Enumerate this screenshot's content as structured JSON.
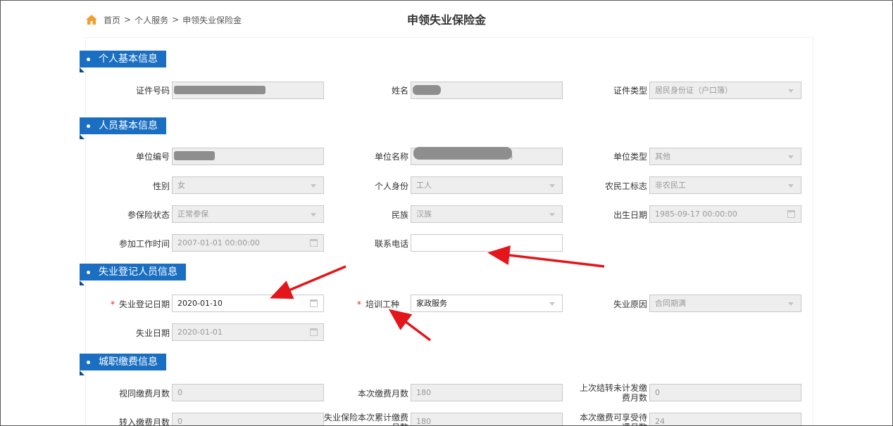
{
  "breadcrumb": {
    "home": "首页",
    "sep": ">",
    "items": [
      "个人服务",
      "申领失业保险金"
    ]
  },
  "page_title": "申领失业保险金",
  "sections": {
    "personal": "个人基本信息",
    "staff": "人员基本信息",
    "unemployment": "失业登记人员信息",
    "payment": "城职缴费信息"
  },
  "fields": {
    "id_number": {
      "label": "证件号码",
      "value": ""
    },
    "name": {
      "label": "姓名",
      "value": ""
    },
    "id_type": {
      "label": "证件类型",
      "value": "居民身份证（户口簿）"
    },
    "unit_code": {
      "label": "单位编号",
      "value": ""
    },
    "unit_name": {
      "label": "单位名称",
      "value": ")"
    },
    "unit_type": {
      "label": "单位类型",
      "value": "其他"
    },
    "gender": {
      "label": "性别",
      "value": "女"
    },
    "identity": {
      "label": "个人身份",
      "value": "工人"
    },
    "migrant_flag": {
      "label": "农民工标志",
      "value": "非农民工"
    },
    "insured_status": {
      "label": "参保险状态",
      "value": "正常参保"
    },
    "ethnicity": {
      "label": "民族",
      "value": "汉族"
    },
    "birth_date": {
      "label": "出生日期",
      "value": "1985-09-17 00:00:00"
    },
    "work_start": {
      "label": "参加工作时间",
      "value": "2007-01-01 00:00:00"
    },
    "phone": {
      "label": "联系电话",
      "value": ""
    },
    "reg_date": {
      "label": "失业登记日期",
      "value": "2020-01-10",
      "required": "*"
    },
    "training": {
      "label": "培训工种",
      "value": "家政服务",
      "required": "*"
    },
    "reason": {
      "label": "失业原因",
      "value": "合同期满"
    },
    "unemp_date": {
      "label": "失业日期",
      "value": "2020-01-01"
    },
    "deemed_months": {
      "label": "视同缴费月数",
      "value": "0"
    },
    "current_months": {
      "label": "本次缴费月数",
      "value": "180"
    },
    "carryover_months": {
      "label": "上次结转未计发缴费月数",
      "value": "0"
    },
    "transfer_months": {
      "label": "转入缴费月数",
      "value": "0"
    },
    "cumulative_months": {
      "label": "失业保险本次累计缴费月数",
      "value": "180"
    },
    "entitled_months": {
      "label": "本次缴费可享受待遇月数",
      "value": "24"
    }
  },
  "colors": {
    "section_blue": "#1a6fc2",
    "arrow_red": "#e3161b",
    "required_red": "#e02020",
    "home_icon": "#f0a030"
  },
  "icons": [
    "home-icon",
    "chevron-down-icon",
    "calendar-icon"
  ]
}
